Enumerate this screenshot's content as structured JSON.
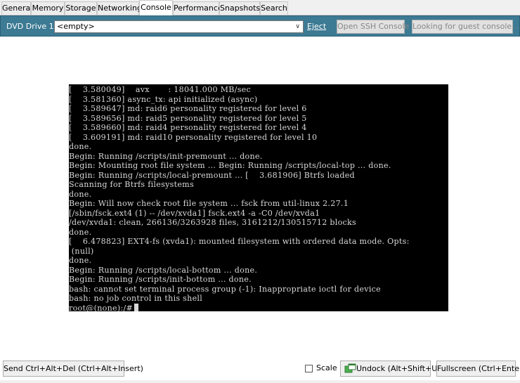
{
  "tabs": [
    {
      "label": "General"
    },
    {
      "label": "Memory"
    },
    {
      "label": "Storage"
    },
    {
      "label": "Networking"
    },
    {
      "label": "Console",
      "active": true
    },
    {
      "label": "Performance"
    },
    {
      "label": "Snapshots"
    },
    {
      "label": "Search"
    }
  ],
  "toolbar": {
    "dvd_label": "DVD Drive 1:",
    "dvd_value": "<empty>",
    "eject_label": "Eject",
    "ssh_button": "Open SSH Console",
    "guest_button": "Looking for guest console..."
  },
  "terminal": {
    "lines": [
      "[    3.580049]    avx       : 18041.000 MB/sec",
      "[    3.581360] async_tx: api initialized (async)",
      "[    3.589647] md: raid6 personality registered for level 6",
      "[    3.589656] md: raid5 personality registered for level 5",
      "[    3.589660] md: raid4 personality registered for level 4",
      "[    3.609191] md: raid10 personality registered for level 10",
      "done.",
      "Begin: Running /scripts/init-premount ... done.",
      "Begin: Mounting root file system ... Begin: Running /scripts/local-top ... done.",
      "Begin: Running /scripts/local-premount ... [    3.681906] Btrfs loaded",
      "Scanning for Btrfs filesystems",
      "done.",
      "Begin: Will now check root file system ... fsck from util-linux 2.27.1",
      "[/sbin/fsck.ext4 (1) -- /dev/xvda1] fsck.ext4 -a -C0 /dev/xvda1",
      "/dev/xvda1: clean, 266136/3263928 files, 3161212/130515712 blocks",
      "done.",
      "[    6.478823] EXT4-fs (xvda1): mounted filesystem with ordered data mode. Opts:",
      " (null)",
      "done.",
      "Begin: Running /scripts/local-bottom ... done.",
      "Begin: Running /scripts/init-bottom ... done.",
      "bash: cannot set terminal process group (-1): Inappropriate ioctl for device",
      "bash: no job control in this shell"
    ],
    "prompt": "root@(none):/#"
  },
  "bottom": {
    "ctrl_alt_del": "Send Ctrl+Alt+Del (Ctrl+Alt+Insert)",
    "scale_label": "Scale",
    "scale_checked": false,
    "undock": "Undock (Alt+Shift+U)",
    "fullscreen": "Fullscreen (Ctrl+Enter)"
  },
  "colors": {
    "toolbar_bg": "#3d7a93",
    "terminal_bg": "#000000",
    "terminal_fg": "#d8d8d8"
  }
}
